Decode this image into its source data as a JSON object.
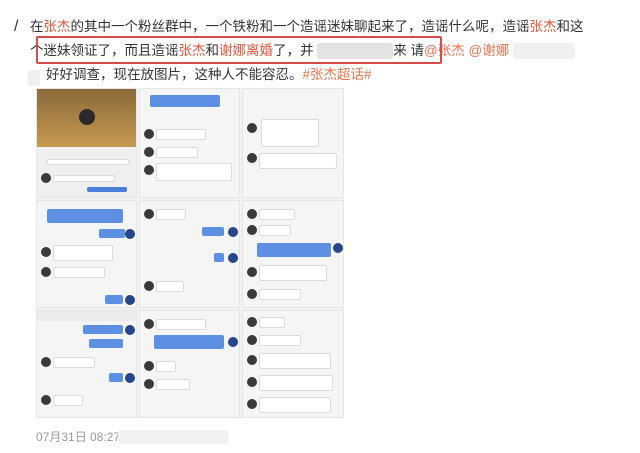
{
  "post": {
    "line1": {
      "a": "在",
      "hl1": "张杰",
      "b": "的其中一个粉丝群中，一个铁粉和一个造谣迷妹聊起来了，造谣什么呢，造谣",
      "hl2": "张杰",
      "c": "和这"
    },
    "line2": {
      "a": "个迷妹领证了，而且造谣",
      "hl1": "张杰",
      "b": "和",
      "hl2": "谢娜离婚",
      "c": "了，并",
      "d": "来",
      "e": " 请",
      "at1": "@张杰",
      "at2": "@谢娜"
    },
    "line3": {
      "a": "好好调查，现在放图片，这种人不能容忍。",
      "tag1": "#张杰",
      "tag2": "超话#"
    }
  },
  "footer": {
    "timestamp": "07月31日 08:27"
  },
  "colors": {
    "highlight": "#e0573b",
    "link": "#eb7350",
    "box": "#d94b4b"
  }
}
